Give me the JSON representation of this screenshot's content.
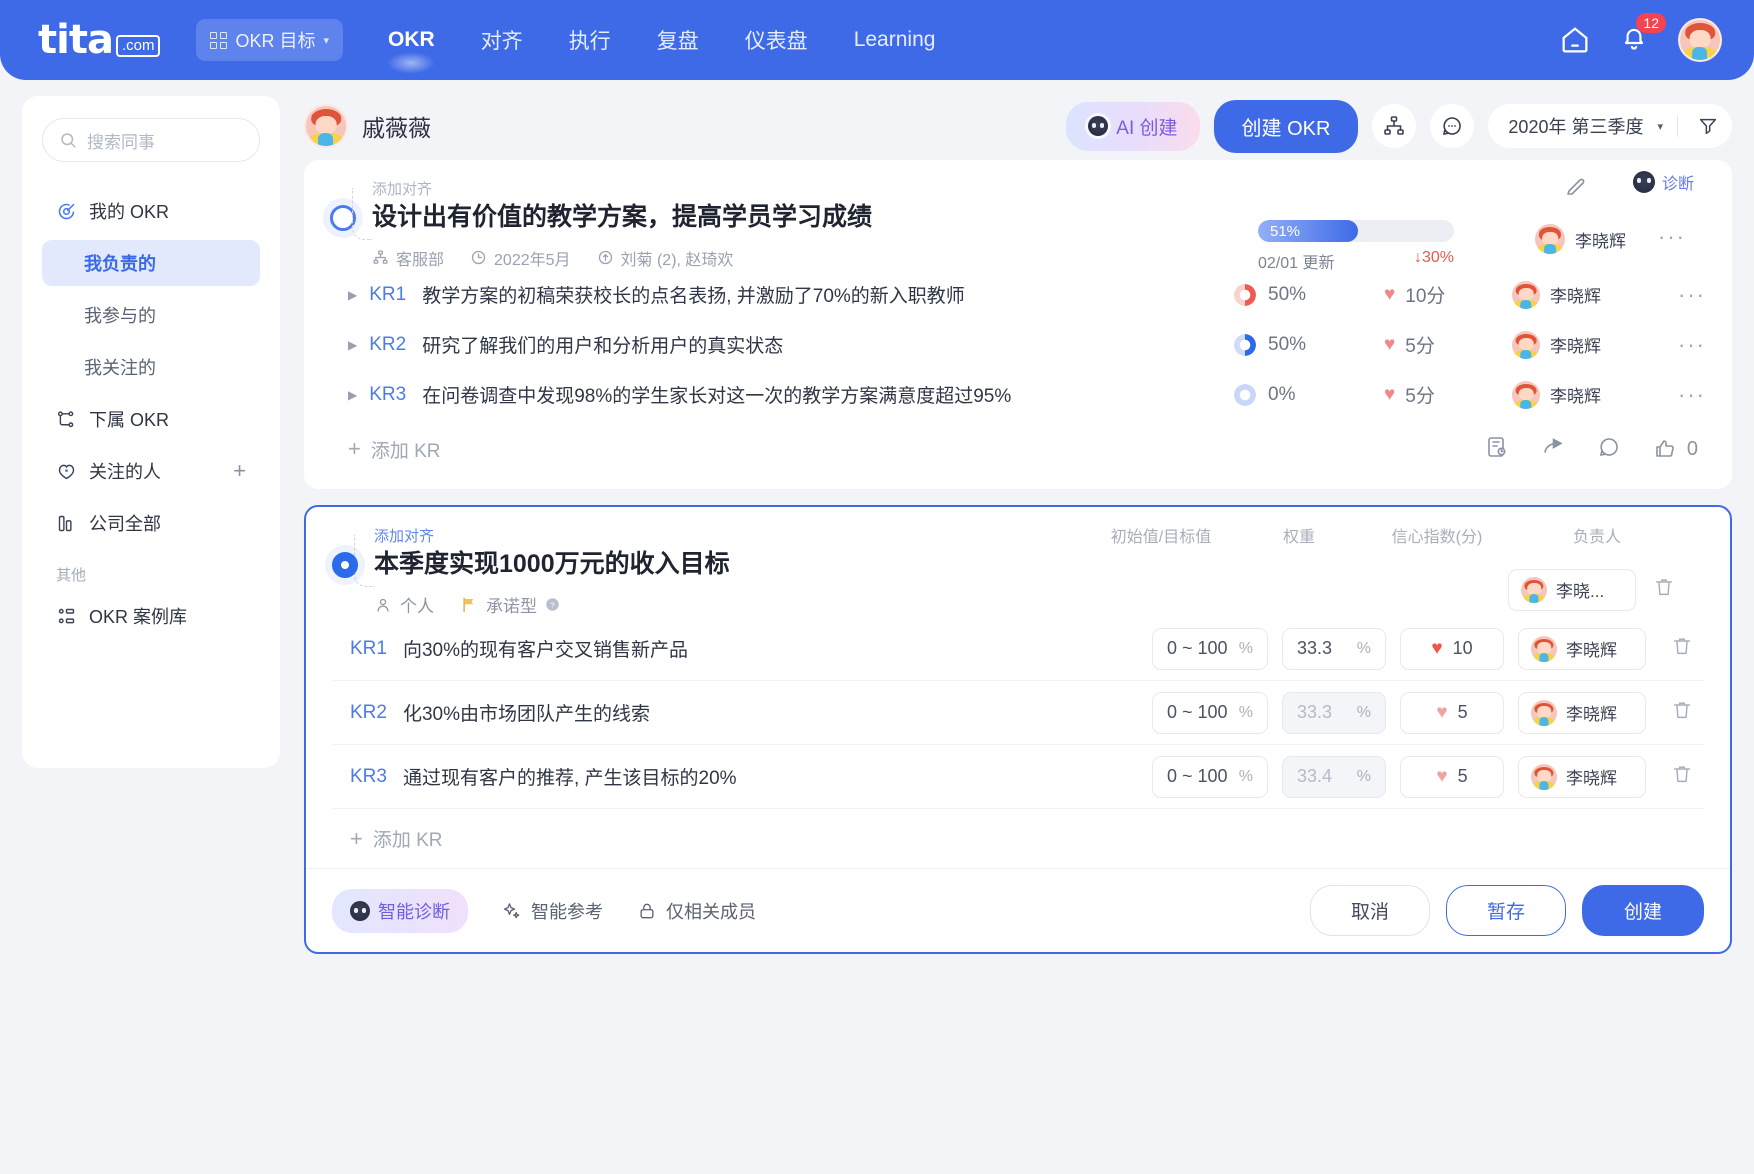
{
  "topnav": {
    "logo_main": "tita",
    "logo_suffix": ".com",
    "workspace": "OKR 目标",
    "items": [
      {
        "label": "OKR",
        "active": true
      },
      {
        "label": "对齐",
        "active": false
      },
      {
        "label": "执行",
        "active": false
      },
      {
        "label": "复盘",
        "active": false
      },
      {
        "label": "仪表盘",
        "active": false
      },
      {
        "label": "Learning",
        "active": false
      }
    ],
    "notification_count": "12",
    "accent": "#3e6ae8"
  },
  "sidebar": {
    "search_placeholder": "搜索同事",
    "items": [
      {
        "label": "我的 OKR",
        "icon": "target-icon",
        "type": "top"
      },
      {
        "label": "我负责的",
        "icon": "",
        "type": "sub",
        "active": true
      },
      {
        "label": "我参与的",
        "icon": "",
        "type": "sub"
      },
      {
        "label": "我关注的",
        "icon": "",
        "type": "sub"
      },
      {
        "label": "下属 OKR",
        "icon": "org-tree-icon",
        "type": "top"
      },
      {
        "label": "关注的人",
        "icon": "heart-shield-icon",
        "type": "top",
        "trailing": "+"
      },
      {
        "label": "公司全部",
        "icon": "bar-chart-icon",
        "type": "top"
      }
    ],
    "section_other": "其他",
    "other_items": [
      {
        "label": "OKR 案例库",
        "icon": "library-icon"
      }
    ]
  },
  "header": {
    "user_name": "戚薇薇",
    "ai_create_label": "AI 创建",
    "create_okr_label": "创建 OKR",
    "period_label": "2020年 第三季度"
  },
  "card1": {
    "align_add": "添加对齐",
    "diagnose_label": "诊断",
    "objective": "设计出有价值的教学方案，提高学员学习成绩",
    "meta": {
      "dept": "客服部",
      "date": "2022年5月",
      "participants": "刘菊 (2), 赵琦欢"
    },
    "progress": {
      "percent_label": "51%",
      "percent_value": 51,
      "updated": "02/01 更新",
      "delta": "↓30%"
    },
    "owner": "李晓辉",
    "krs": [
      {
        "label": "KR1",
        "text": "教学方案的初稿荣获校长的点名表扬, 并激励了70%的新入职教师",
        "percent": "50%",
        "ring_color": "#ef5a52",
        "ring_value": 50,
        "score": "10分",
        "owner": "李晓辉"
      },
      {
        "label": "KR2",
        "text": "研究了解我们的用户和分析用户的真实状态",
        "percent": "50%",
        "ring_color": "#2b6ae8",
        "ring_value": 50,
        "score": "5分",
        "owner": "李晓辉"
      },
      {
        "label": "KR3",
        "text": "在问卷调查中发现98%的学生家长对这一次的教学方案满意度超过95%",
        "percent": "0%",
        "ring_color": "#c9d6f7",
        "ring_value": 0,
        "score": "5分",
        "owner": "李晓辉"
      }
    ],
    "add_kr": "添加 KR",
    "like_count": "0"
  },
  "card2": {
    "align_add": "添加对齐",
    "col_heads": [
      "初始值/目标值",
      "权重",
      "信心指数(分)",
      "负责人"
    ],
    "objective": "本季度实现1000万元的收入目标",
    "tags": {
      "scope": "个人",
      "type": "承诺型"
    },
    "owner_short": "李晓...",
    "krs": [
      {
        "label": "KR1",
        "text": "向30%的现有客户交叉销售新产品",
        "range": "0 ~ 100",
        "range_unit": "%",
        "weight": "33.3",
        "weight_unit": "%",
        "confidence": "10",
        "confidence_filled": true,
        "owner": "李晓辉",
        "disabled": false
      },
      {
        "label": "KR2",
        "text": "化30%由市场团队产生的线索",
        "range": "0 ~ 100",
        "range_unit": "%",
        "weight": "33.3",
        "weight_unit": "%",
        "confidence": "5",
        "confidence_filled": false,
        "owner": "李晓辉",
        "disabled": true
      },
      {
        "label": "KR3",
        "text": "通过现有客户的推荐, 产生该目标的20%",
        "range": "0 ~ 100",
        "range_unit": "%",
        "weight": "33.4",
        "weight_unit": "%",
        "confidence": "5",
        "confidence_filled": false,
        "owner": "李晓辉",
        "disabled": true
      }
    ],
    "add_kr": "添加 KR",
    "footer": {
      "smart_diagnose": "智能诊断",
      "smart_reference": "智能参考",
      "members_only": "仅相关成员",
      "cancel": "取消",
      "save_draft": "暂存",
      "create": "创建"
    }
  }
}
